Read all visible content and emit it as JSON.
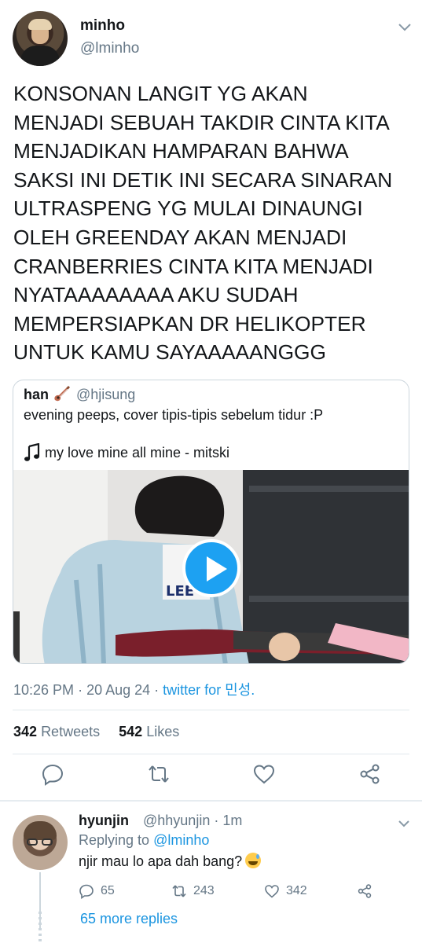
{
  "tweet": {
    "author_name": "minho",
    "author_handle": "@lminho",
    "text_lines": [
      "KONSONAN LANGIT YG AKAN",
      "MENJADI SEBUAH TAKDIR CINTA KITA",
      "MENJADIKAN HAMPARAN BAHWA",
      "SAKSI INI DETIK INI SECARA SINARAN",
      "ULTRASPENG YG MULAI DINAUNGI",
      "OLEH GREENDAY AKAN MENJADI",
      "CRANBERRIES CINTA KITA MENJADI",
      "NYATAAAAAAAA AKU SUDAH",
      "MEMPERSIAPKAN DR HELIKOPTER",
      "UNTUK KAMU SAYAAAAANGGG"
    ],
    "time": "10:26 PM",
    "date": "20 Aug 24",
    "source": "twitter for 민성.",
    "retweets_count": "342",
    "retweets_label": "Retweets",
    "likes_count": "542",
    "likes_label": "Likes"
  },
  "quoted": {
    "name": "han",
    "name_emoji_icon": "guitar-icon",
    "handle": "@hjisung",
    "text_line1": "evening peeps, cover tipis-tipis sebelum tidur :P",
    "text_line2": "my love mine all mine - mitski",
    "media_type": "video"
  },
  "reply": {
    "name": "hyunjin",
    "handle": "@hhyunjin",
    "time": "1m",
    "replying_prefix": "Replying to",
    "replying_handle": "@lminho",
    "text": "njir mau lo apa dah bang?",
    "replies_count": "65",
    "retweets_count": "243",
    "likes_count": "342",
    "more_replies": "65 more replies"
  },
  "colors": {
    "accent": "#1da1f2",
    "link": "#1b95e0",
    "secondary_text": "#657786",
    "primary_text": "#14171a",
    "divider": "#e1e8ed"
  }
}
